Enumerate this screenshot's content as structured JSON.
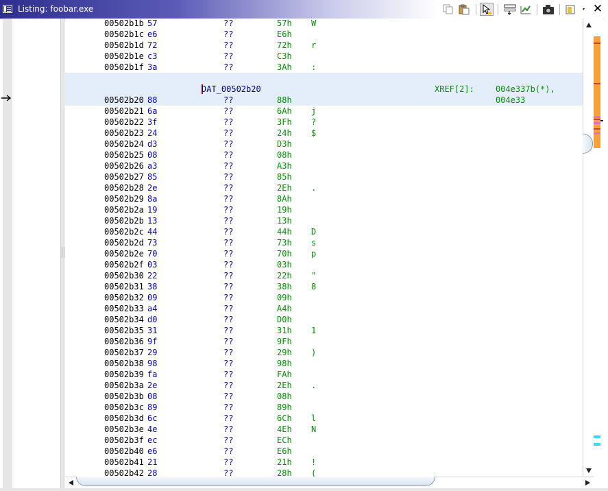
{
  "window": {
    "title": "Listing:  foobar.exe"
  },
  "toolbar": {
    "buttons": [
      {
        "name": "copy-icon"
      },
      {
        "name": "paste-icon"
      },
      {
        "name": "cursor-select-icon",
        "pressed": true
      },
      {
        "name": "field-layout-icon"
      },
      {
        "name": "diff-icon"
      },
      {
        "name": "snapshot-camera-icon"
      },
      {
        "name": "options-dropdown-icon"
      },
      {
        "name": "close-icon",
        "label": "✕"
      }
    ]
  },
  "listing": {
    "rows_before": [
      {
        "addr": "00502b1b",
        "byte": "57",
        "mnemonic": "??",
        "value": "57h",
        "char": "W"
      },
      {
        "addr": "00502b1c",
        "byte": "e6",
        "mnemonic": "??",
        "value": "E6h",
        "char": ""
      },
      {
        "addr": "00502b1d",
        "byte": "72",
        "mnemonic": "??",
        "value": "72h",
        "char": "r"
      },
      {
        "addr": "00502b1e",
        "byte": "c3",
        "mnemonic": "??",
        "value": "C3h",
        "char": ""
      },
      {
        "addr": "00502b1f",
        "byte": "3a",
        "mnemonic": "??",
        "value": "3Ah",
        "char": ":"
      }
    ],
    "label_block": {
      "label": "DAT_00502b20",
      "xref_label": "XREF[2]:",
      "xref_addrs": "004e337b(*),  004e33",
      "row": {
        "addr": "00502b20",
        "byte": "88",
        "mnemonic": "??",
        "value": "88h",
        "char": ""
      }
    },
    "rows_after": [
      {
        "addr": "00502b21",
        "byte": "6a",
        "mnemonic": "??",
        "value": "6Ah",
        "char": "j"
      },
      {
        "addr": "00502b22",
        "byte": "3f",
        "mnemonic": "??",
        "value": "3Fh",
        "char": "?"
      },
      {
        "addr": "00502b23",
        "byte": "24",
        "mnemonic": "??",
        "value": "24h",
        "char": "$"
      },
      {
        "addr": "00502b24",
        "byte": "d3",
        "mnemonic": "??",
        "value": "D3h",
        "char": ""
      },
      {
        "addr": "00502b25",
        "byte": "08",
        "mnemonic": "??",
        "value": "08h",
        "char": ""
      },
      {
        "addr": "00502b26",
        "byte": "a3",
        "mnemonic": "??",
        "value": "A3h",
        "char": ""
      },
      {
        "addr": "00502b27",
        "byte": "85",
        "mnemonic": "??",
        "value": "85h",
        "char": ""
      },
      {
        "addr": "00502b28",
        "byte": "2e",
        "mnemonic": "??",
        "value": "2Eh",
        "char": "."
      },
      {
        "addr": "00502b29",
        "byte": "8a",
        "mnemonic": "??",
        "value": "8Ah",
        "char": ""
      },
      {
        "addr": "00502b2a",
        "byte": "19",
        "mnemonic": "??",
        "value": "19h",
        "char": ""
      },
      {
        "addr": "00502b2b",
        "byte": "13",
        "mnemonic": "??",
        "value": "13h",
        "char": ""
      },
      {
        "addr": "00502b2c",
        "byte": "44",
        "mnemonic": "??",
        "value": "44h",
        "char": "D"
      },
      {
        "addr": "00502b2d",
        "byte": "73",
        "mnemonic": "??",
        "value": "73h",
        "char": "s"
      },
      {
        "addr": "00502b2e",
        "byte": "70",
        "mnemonic": "??",
        "value": "70h",
        "char": "p"
      },
      {
        "addr": "00502b2f",
        "byte": "03",
        "mnemonic": "??",
        "value": "03h",
        "char": ""
      },
      {
        "addr": "00502b30",
        "byte": "22",
        "mnemonic": "??",
        "value": "22h",
        "char": "\""
      },
      {
        "addr": "00502b31",
        "byte": "38",
        "mnemonic": "??",
        "value": "38h",
        "char": "8"
      },
      {
        "addr": "00502b32",
        "byte": "09",
        "mnemonic": "??",
        "value": "09h",
        "char": ""
      },
      {
        "addr": "00502b33",
        "byte": "a4",
        "mnemonic": "??",
        "value": "A4h",
        "char": ""
      },
      {
        "addr": "00502b34",
        "byte": "d0",
        "mnemonic": "??",
        "value": "D0h",
        "char": ""
      },
      {
        "addr": "00502b35",
        "byte": "31",
        "mnemonic": "??",
        "value": "31h",
        "char": "1"
      },
      {
        "addr": "00502b36",
        "byte": "9f",
        "mnemonic": "??",
        "value": "9Fh",
        "char": ""
      },
      {
        "addr": "00502b37",
        "byte": "29",
        "mnemonic": "??",
        "value": "29h",
        "char": ")"
      },
      {
        "addr": "00502b38",
        "byte": "98",
        "mnemonic": "??",
        "value": "98h",
        "char": ""
      },
      {
        "addr": "00502b39",
        "byte": "fa",
        "mnemonic": "??",
        "value": "FAh",
        "char": ""
      },
      {
        "addr": "00502b3a",
        "byte": "2e",
        "mnemonic": "??",
        "value": "2Eh",
        "char": "."
      },
      {
        "addr": "00502b3b",
        "byte": "08",
        "mnemonic": "??",
        "value": "08h",
        "char": ""
      },
      {
        "addr": "00502b3c",
        "byte": "89",
        "mnemonic": "??",
        "value": "89h",
        "char": ""
      },
      {
        "addr": "00502b3d",
        "byte": "6c",
        "mnemonic": "??",
        "value": "6Ch",
        "char": "l"
      },
      {
        "addr": "00502b3e",
        "byte": "4e",
        "mnemonic": "??",
        "value": "4Eh",
        "char": "N"
      },
      {
        "addr": "00502b3f",
        "byte": "ec",
        "mnemonic": "??",
        "value": "ECh",
        "char": ""
      },
      {
        "addr": "00502b40",
        "byte": "e6",
        "mnemonic": "??",
        "value": "E6h",
        "char": ""
      },
      {
        "addr": "00502b41",
        "byte": "21",
        "mnemonic": "??",
        "value": "21h",
        "char": "!"
      },
      {
        "addr": "00502b42",
        "byte": "28",
        "mnemonic": "??",
        "value": "28h",
        "char": "("
      }
    ]
  },
  "colors": {
    "address": "#000000",
    "byte": "#0000c8",
    "mnemonic": "#000080",
    "value": "#009000",
    "label_highlight": "#e4eefb",
    "overview_data": "#f7a13a"
  }
}
